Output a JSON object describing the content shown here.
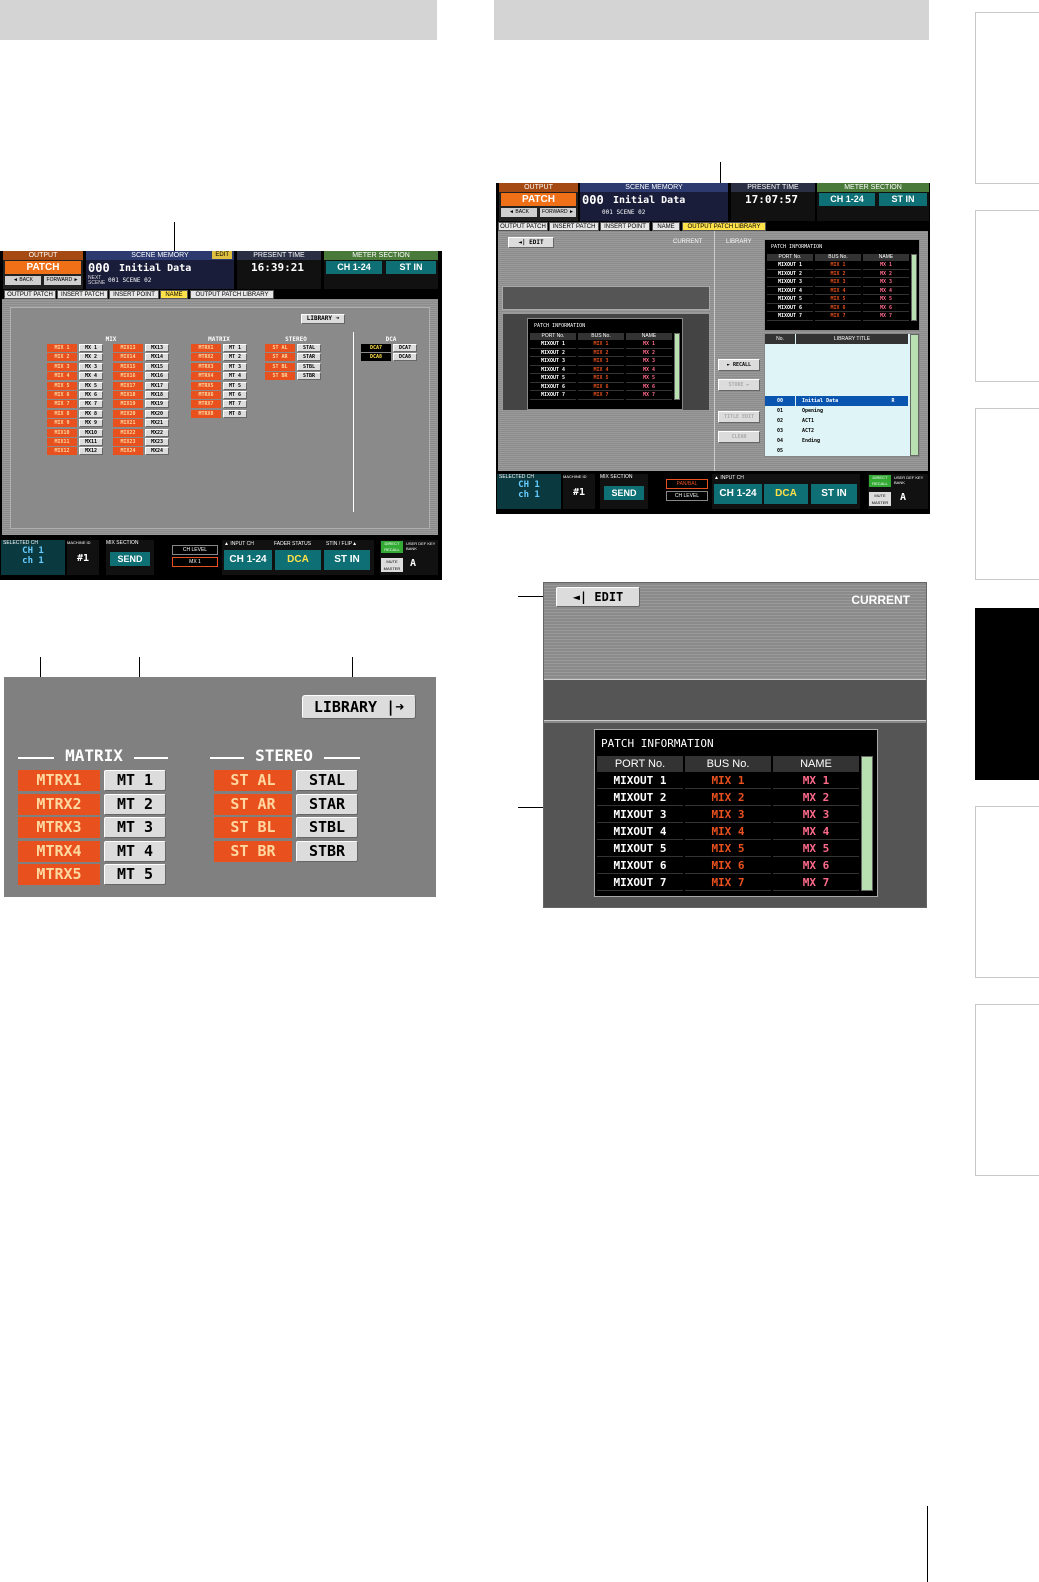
{
  "panel1": {
    "output_label": "OUTPUT",
    "patch_label": "PATCH",
    "scene_memory_label": "SCENE MEMORY",
    "edit_badge": "EDIT",
    "scene_number": "000",
    "scene_title": "Initial Data",
    "back_label": "◄ BACK",
    "forward_label": "FORWARD ►",
    "next_scene_label": "NEXT SCENE",
    "next_scene_value": "001 SCENE 02",
    "present_time_label": "PRESENT TIME",
    "present_time": "16:39:21",
    "meter_section_label": "METER SECTION",
    "meter_ch": "CH 1-24",
    "meter_stin": "ST IN",
    "tabs": [
      "OUTPUT PATCH",
      "INSERT PATCH",
      "INSERT POINT",
      "NAME",
      "OUTPUT PATCH LIBRARY"
    ],
    "library_button": "LIBRARY ➜",
    "group_mix": "MIX",
    "group_matrix": "MATRIX",
    "group_stereo": "STEREO",
    "group_dca": "DCA",
    "mix_col1": [
      [
        "MIX 1",
        "MX 1"
      ],
      [
        "MIX 2",
        "MX 2"
      ],
      [
        "MIX 3",
        "MX 3"
      ],
      [
        "MIX 4",
        "MX 4"
      ],
      [
        "MIX 5",
        "MX 5"
      ],
      [
        "MIX 6",
        "MX 6"
      ],
      [
        "MIX 7",
        "MX 7"
      ],
      [
        "MIX 8",
        "MX 8"
      ],
      [
        "MIX 9",
        "MX 9"
      ],
      [
        "MIX10",
        "MX10"
      ],
      [
        "MIX11",
        "MX11"
      ],
      [
        "MIX12",
        "MX12"
      ]
    ],
    "mix_col2": [
      [
        "MIX13",
        "MX13"
      ],
      [
        "MIX14",
        "MX14"
      ],
      [
        "MIX15",
        "MX15"
      ],
      [
        "MIX16",
        "MX16"
      ],
      [
        "MIX17",
        "MX17"
      ],
      [
        "MIX18",
        "MX18"
      ],
      [
        "MIX19",
        "MX19"
      ],
      [
        "MIX20",
        "MX20"
      ],
      [
        "MIX21",
        "MX21"
      ],
      [
        "MIX22",
        "MX22"
      ],
      [
        "MIX23",
        "MX23"
      ],
      [
        "MIX24",
        "MX24"
      ]
    ],
    "matrix": [
      [
        "MTRX1",
        "MT 1"
      ],
      [
        "MTRX2",
        "MT 2"
      ],
      [
        "MTRX3",
        "MT 3"
      ],
      [
        "MTRX4",
        "MT 4"
      ],
      [
        "MTRX5",
        "MT 5"
      ],
      [
        "MTRX6",
        "MT 6"
      ],
      [
        "MTRX7",
        "MT 7"
      ],
      [
        "MTRX8",
        "MT 8"
      ]
    ],
    "stereo": [
      [
        "ST AL",
        "STAL"
      ],
      [
        "ST AR",
        "STAR"
      ],
      [
        "ST BL",
        "STBL"
      ],
      [
        "ST BR",
        "STBR"
      ]
    ],
    "dca": [
      [
        "DCA7",
        "DCA7"
      ],
      [
        "DCA8",
        "DCA8"
      ]
    ],
    "selected_ch_label": "SELECTED CH",
    "selected_ch": "CH 1",
    "selected_ch_name": "ch 1",
    "machine_id_label": "MACHINE ID",
    "machine_id": "#1",
    "mix_section_label": "MIX SECTION",
    "mix_send": "SEND",
    "ch_level": "CH LEVEL",
    "mix_value": "MX 1",
    "input_ch_label": "▲ INPUT CH",
    "input_ch": "CH 1-24",
    "fader_status_label": "FADER STATUS",
    "fader_dca": "DCA",
    "stin_flip_label": "STIN / FLIP▲",
    "stin": "ST IN",
    "direct_recall": "DIRECT RECALL",
    "user_def_label": "USER DEF KEY BANK",
    "mute_master": "MUTE MASTER",
    "user_def_value": "A"
  },
  "panel2": {
    "output_label": "OUTPUT",
    "patch_label": "PATCH",
    "scene_memory_label": "SCENE MEMORY",
    "scene_number": "000",
    "scene_title": "Initial Data",
    "back_label": "◄ BACK",
    "forward_label": "FORWARD ►",
    "next_scene_value": "001 SCENE 02",
    "present_time_label": "PRESENT TIME",
    "present_time": "17:07:57",
    "meter_section_label": "METER SECTION",
    "meter_ch": "CH 1-24",
    "meter_stin": "ST IN",
    "tabs": [
      "OUTPUT PATCH",
      "INSERT PATCH",
      "INSERT POINT",
      "NAME",
      "OUTPUT PATCH LIBRARY"
    ],
    "edit_button": "◄| EDIT",
    "current_label": "CURRENT",
    "library_label": "LIBRARY",
    "patch_info_title": "PATCH INFORMATION",
    "columns": [
      "PORT No.",
      "BUS No.",
      "NAME"
    ],
    "rows": [
      [
        "MIXOUT 1",
        "MIX 1",
        "MX 1"
      ],
      [
        "MIXOUT 2",
        "MIX 2",
        "MX 2"
      ],
      [
        "MIXOUT 3",
        "MIX 3",
        "MX 3"
      ],
      [
        "MIXOUT 4",
        "MIX 4",
        "MX 4"
      ],
      [
        "MIXOUT 5",
        "MIX 5",
        "MX 5"
      ],
      [
        "MIXOUT 6",
        "MIX 6",
        "MX 6"
      ],
      [
        "MIXOUT 7",
        "MIX 7",
        "MX 7"
      ]
    ],
    "recall_button": "► RECALL",
    "store_button": "STORE ►",
    "title_edit_button": "TITLE EDIT",
    "clear_button": "CLEAR",
    "lib_columns": [
      "No.",
      "LIBRARY TITLE"
    ],
    "lib_rows": [
      [
        "00",
        "Initial Data",
        "R"
      ],
      [
        "01",
        "Opening",
        ""
      ],
      [
        "02",
        "ACT1",
        ""
      ],
      [
        "03",
        "ACT2",
        ""
      ],
      [
        "04",
        "Ending",
        ""
      ],
      [
        "05",
        "",
        ""
      ]
    ],
    "selected_ch_label": "SELECTED CH",
    "selected_ch": "CH 1",
    "selected_ch_name": "ch 1",
    "machine_id_label": "MACHINE ID",
    "machine_id": "#1",
    "mix_section_label": "MIX SECTION",
    "mix_send": "SEND",
    "pan_bal": "PAN/BAL",
    "ch_level": "CH LEVEL",
    "input_ch_label": "▲ INPUT CH",
    "input_ch": "CH 1-24",
    "fader_dca": "DCA",
    "stin": "ST IN",
    "direct_recall": "DIRECT RECALL",
    "user_def_label": "USER DEF KEY BANK",
    "mute_master": "MUTE MASTER",
    "user_def_value": "A"
  },
  "zoom1": {
    "library_button": "LIBRARY |➜",
    "matrix_label": "MATRIX",
    "stereo_label": "STEREO",
    "matrix_rows": [
      [
        "MTRX1",
        "MT 1"
      ],
      [
        "MTRX2",
        "MT 2"
      ],
      [
        "MTRX3",
        "MT 3"
      ],
      [
        "MTRX4",
        "MT 4"
      ],
      [
        "MTRX5",
        "MT 5"
      ]
    ],
    "stereo_rows": [
      [
        "ST AL",
        "STAL"
      ],
      [
        "ST AR",
        "STAR"
      ],
      [
        "ST BL",
        "STBL"
      ],
      [
        "ST BR",
        "STBR"
      ]
    ]
  },
  "zoom2": {
    "edit_button": "◄| EDIT",
    "current_label": "CURRENT",
    "patch_info_title": "PATCH INFORMATION",
    "columns": [
      "PORT No.",
      "BUS No.",
      "NAME"
    ],
    "rows": [
      [
        "MIXOUT 1",
        "MIX 1",
        "MX 1"
      ],
      [
        "MIXOUT 2",
        "MIX 2",
        "MX 2"
      ],
      [
        "MIXOUT 3",
        "MIX 3",
        "MX 3"
      ],
      [
        "MIXOUT 4",
        "MIX 4",
        "MX 4"
      ],
      [
        "MIXOUT 5",
        "MIX 5",
        "MX 5"
      ],
      [
        "MIXOUT 6",
        "MIX 6",
        "MX 6"
      ],
      [
        "MIXOUT 7",
        "MIX 7",
        "MX 7"
      ]
    ]
  },
  "colors": {
    "orange": "#e8501e",
    "teal": "#0e6f75",
    "yellow_tab": "#ffe14a",
    "green_scroll": "#b8e0b0"
  }
}
